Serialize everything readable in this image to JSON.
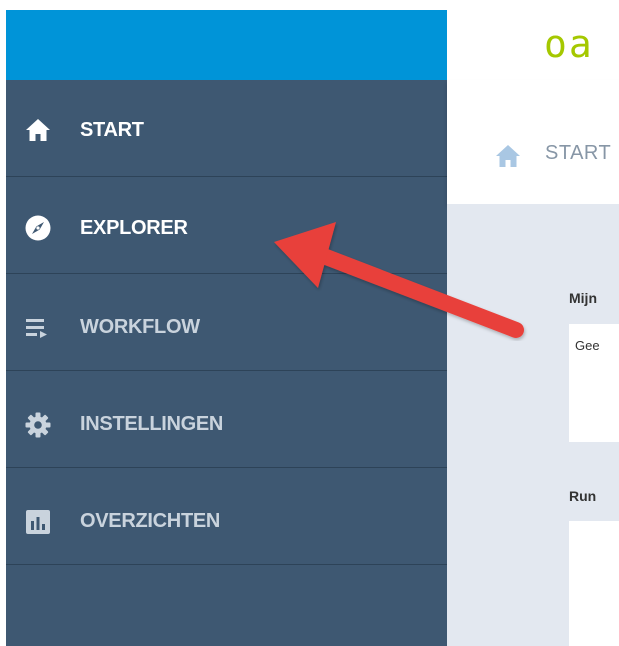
{
  "brand": {
    "text": "oa"
  },
  "sidebar": {
    "items": [
      {
        "label": "START",
        "icon": "home-icon",
        "active": true
      },
      {
        "label": "EXPLORER",
        "icon": "compass-icon",
        "active": true
      },
      {
        "label": "WORKFLOW",
        "icon": "workflow-list-icon",
        "active": false
      },
      {
        "label": "INSTELLINGEN",
        "icon": "gear-icon",
        "active": false
      },
      {
        "label": "OVERZICHTEN",
        "icon": "bar-chart-icon",
        "active": false
      }
    ]
  },
  "breadcrumb": {
    "label": "START",
    "icon": "home-icon"
  },
  "main": {
    "section1_label": "Mijn",
    "section1_text": "Gee",
    "section2_label": "Run"
  },
  "colors": {
    "sidebar_bg": "#3e5872",
    "top_bar_blue": "#0094d8",
    "brand_green": "#a5c800",
    "arrow_red": "#e8413a"
  }
}
